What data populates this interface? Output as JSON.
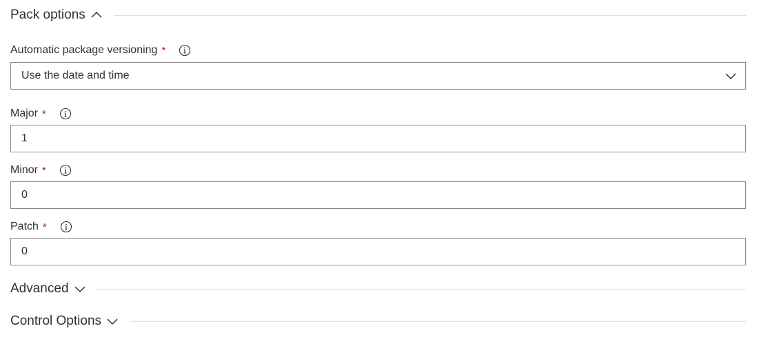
{
  "sections": {
    "pack_options": {
      "title": "Pack options",
      "expanded": true
    },
    "advanced": {
      "title": "Advanced",
      "expanded": false
    },
    "control_options": {
      "title": "Control Options",
      "expanded": false
    }
  },
  "fields": {
    "versioning": {
      "label": "Automatic package versioning",
      "required_mark": "*",
      "selected": "Use the date and time"
    },
    "major": {
      "label": "Major",
      "required_mark": "*",
      "value": "1"
    },
    "minor": {
      "label": "Minor",
      "required_mark": "*",
      "value": "0"
    },
    "patch": {
      "label": "Patch",
      "required_mark": "*",
      "value": "0"
    }
  },
  "icons": {
    "section_expanded": "chevron-up-icon",
    "section_collapsed": "chevron-down-icon",
    "info": "info-icon",
    "dropdown": "chevron-down-icon"
  },
  "colors": {
    "text": "#323130",
    "required": "#a4262c",
    "border": "#8a8886",
    "divider": "#e1dfdd"
  }
}
